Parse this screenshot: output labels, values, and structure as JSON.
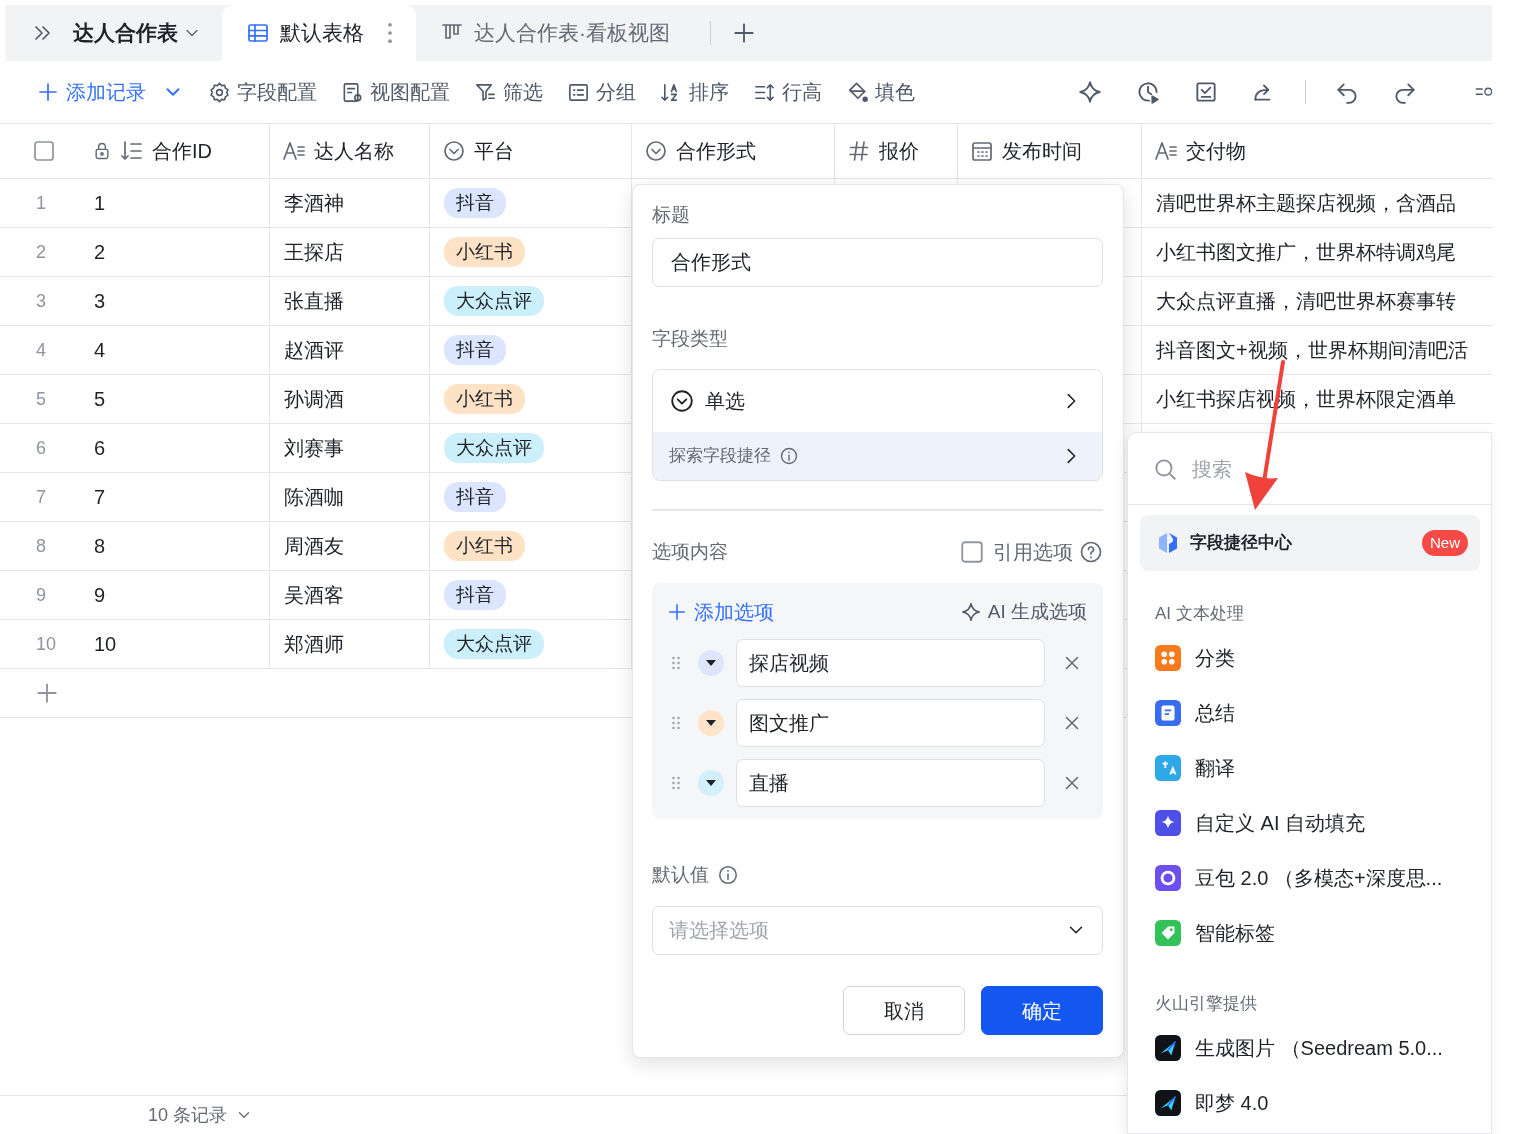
{
  "tab_bar": {
    "breadcrumb": "达人合作表",
    "tabs": [
      {
        "label": "默认表格",
        "kind": "grid",
        "selected": true
      },
      {
        "label": "达人合作表·看板视图",
        "kind": "kanban",
        "selected": false
      }
    ]
  },
  "toolbar": {
    "add_record": "添加记录",
    "buttons": [
      {
        "label": "字段配置",
        "kind": "gear"
      },
      {
        "label": "视图配置",
        "kind": "view"
      },
      {
        "label": "筛选",
        "kind": "filter"
      },
      {
        "label": "分组",
        "kind": "group"
      },
      {
        "label": "排序",
        "kind": "sort"
      },
      {
        "label": "行高",
        "kind": "height"
      },
      {
        "label": "填色",
        "kind": "fill"
      }
    ]
  },
  "table": {
    "select_all_checked": false,
    "columns": [
      {
        "label": "合作ID",
        "kind": "id"
      },
      {
        "label": "达人名称",
        "kind": "text"
      },
      {
        "label": "平台",
        "kind": "select"
      },
      {
        "label": "合作形式",
        "kind": "select"
      },
      {
        "label": "报价",
        "kind": "number"
      },
      {
        "label": "发布时间",
        "kind": "date"
      },
      {
        "label": "交付物",
        "kind": "text"
      }
    ],
    "rows": [
      {
        "row_number": "1",
        "id": "1",
        "name": "李酒神",
        "platform": {
          "label": "抖音",
          "color": "#dbe5fd"
        },
        "deliverable": "清吧世界杯主题探店视频，含酒品"
      },
      {
        "row_number": "2",
        "id": "2",
        "name": "王探店",
        "platform": {
          "label": "小红书",
          "color": "#fde2c5"
        },
        "deliverable": "小红书图文推广，世界杯特调鸡尾"
      },
      {
        "row_number": "3",
        "id": "3",
        "name": "张直播",
        "platform": {
          "label": "大众点评",
          "color": "#ccf0fb"
        },
        "deliverable": "大众点评直播，清吧世界杯赛事转"
      },
      {
        "row_number": "4",
        "id": "4",
        "name": "赵酒评",
        "platform": {
          "label": "抖音",
          "color": "#dbe5fd"
        },
        "deliverable": "抖音图文+视频，世界杯期间清吧活"
      },
      {
        "row_number": "5",
        "id": "5",
        "name": "孙调酒",
        "platform": {
          "label": "小红书",
          "color": "#fde2c5"
        },
        "deliverable": "小红书探店视频，世界杯限定酒单"
      },
      {
        "row_number": "6",
        "id": "6",
        "name": "刘赛事",
        "platform": {
          "label": "大众点评",
          "color": "#ccf0fb"
        }
      },
      {
        "row_number": "7",
        "id": "7",
        "name": "陈酒咖",
        "platform": {
          "label": "抖音",
          "color": "#dbe5fd"
        }
      },
      {
        "row_number": "8",
        "id": "8",
        "name": "周酒友",
        "platform": {
          "label": "小红书",
          "color": "#fde2c5"
        }
      },
      {
        "row_number": "9",
        "id": "9",
        "name": "吴酒客",
        "platform": {
          "label": "抖音",
          "color": "#dbe5fd"
        }
      },
      {
        "row_number": "10",
        "id": "10",
        "name": "郑酒师",
        "platform": {
          "label": "大众点评",
          "color": "#ccf0fb"
        }
      }
    ]
  },
  "status_bar": {
    "record_count": "10 条记录"
  },
  "field_dialog": {
    "title_label": "标题",
    "title_value": "合作形式",
    "type_label": "字段类型",
    "field_type": "单选",
    "explore": "探索字段捷径",
    "options_label": "选项内容",
    "reference_options": {
      "label": "引用选项",
      "checked": false
    },
    "add_option": "添加选项",
    "ai_generate": "AI 生成选项",
    "options": [
      {
        "label": "探店视频",
        "color": "#dde6fd"
      },
      {
        "label": "图文推广",
        "color": "#fde3c8"
      },
      {
        "label": "直播",
        "color": "#d2f0fb"
      }
    ],
    "default_label": "默认值",
    "default_placeholder": "请选择选项",
    "cancel": "取消",
    "confirm": "确定"
  },
  "field_menu": {
    "search_placeholder": "搜索",
    "featured": {
      "label": "字段捷径中心",
      "badge": "New",
      "highlighted": true
    },
    "sections": [
      {
        "title": "AI 文本处理",
        "items": [
          {
            "label": "分类",
            "kind": "classify",
            "color": "#f77a1c"
          },
          {
            "label": "总结",
            "kind": "summary",
            "color": "#3a6cf0"
          },
          {
            "label": "翻译",
            "kind": "translate",
            "color": "#2fa8e8"
          },
          {
            "label": "自定义 AI 自动填充",
            "kind": "sparkle",
            "color": "#4e4fe8"
          },
          {
            "label": "豆包 2.0 （多模态+深度思...",
            "kind": "doubao",
            "color": "#6b4ff0"
          },
          {
            "label": "智能标签",
            "kind": "tag",
            "color": "#33c15a"
          }
        ]
      },
      {
        "title": "火山引擎提供",
        "items": [
          {
            "label": "生成图片 （Seedream 5.0...",
            "kind": "plane",
            "color": "#101418"
          },
          {
            "label": "即梦 4.0",
            "kind": "plane",
            "color": "#101418"
          }
        ]
      }
    ]
  }
}
